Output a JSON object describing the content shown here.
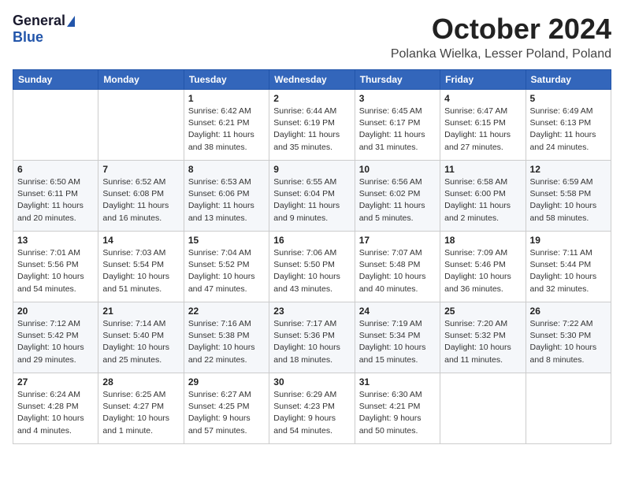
{
  "header": {
    "logo_general": "General",
    "logo_blue": "Blue",
    "month_title": "October 2024",
    "location": "Polanka Wielka, Lesser Poland, Poland"
  },
  "days_of_week": [
    "Sunday",
    "Monday",
    "Tuesday",
    "Wednesday",
    "Thursday",
    "Friday",
    "Saturday"
  ],
  "weeks": [
    [
      {
        "day": "",
        "sunrise": "",
        "sunset": "",
        "daylight": ""
      },
      {
        "day": "",
        "sunrise": "",
        "sunset": "",
        "daylight": ""
      },
      {
        "day": "1",
        "sunrise": "Sunrise: 6:42 AM",
        "sunset": "Sunset: 6:21 PM",
        "daylight": "Daylight: 11 hours and 38 minutes."
      },
      {
        "day": "2",
        "sunrise": "Sunrise: 6:44 AM",
        "sunset": "Sunset: 6:19 PM",
        "daylight": "Daylight: 11 hours and 35 minutes."
      },
      {
        "day": "3",
        "sunrise": "Sunrise: 6:45 AM",
        "sunset": "Sunset: 6:17 PM",
        "daylight": "Daylight: 11 hours and 31 minutes."
      },
      {
        "day": "4",
        "sunrise": "Sunrise: 6:47 AM",
        "sunset": "Sunset: 6:15 PM",
        "daylight": "Daylight: 11 hours and 27 minutes."
      },
      {
        "day": "5",
        "sunrise": "Sunrise: 6:49 AM",
        "sunset": "Sunset: 6:13 PM",
        "daylight": "Daylight: 11 hours and 24 minutes."
      }
    ],
    [
      {
        "day": "6",
        "sunrise": "Sunrise: 6:50 AM",
        "sunset": "Sunset: 6:11 PM",
        "daylight": "Daylight: 11 hours and 20 minutes."
      },
      {
        "day": "7",
        "sunrise": "Sunrise: 6:52 AM",
        "sunset": "Sunset: 6:08 PM",
        "daylight": "Daylight: 11 hours and 16 minutes."
      },
      {
        "day": "8",
        "sunrise": "Sunrise: 6:53 AM",
        "sunset": "Sunset: 6:06 PM",
        "daylight": "Daylight: 11 hours and 13 minutes."
      },
      {
        "day": "9",
        "sunrise": "Sunrise: 6:55 AM",
        "sunset": "Sunset: 6:04 PM",
        "daylight": "Daylight: 11 hours and 9 minutes."
      },
      {
        "day": "10",
        "sunrise": "Sunrise: 6:56 AM",
        "sunset": "Sunset: 6:02 PM",
        "daylight": "Daylight: 11 hours and 5 minutes."
      },
      {
        "day": "11",
        "sunrise": "Sunrise: 6:58 AM",
        "sunset": "Sunset: 6:00 PM",
        "daylight": "Daylight: 11 hours and 2 minutes."
      },
      {
        "day": "12",
        "sunrise": "Sunrise: 6:59 AM",
        "sunset": "Sunset: 5:58 PM",
        "daylight": "Daylight: 10 hours and 58 minutes."
      }
    ],
    [
      {
        "day": "13",
        "sunrise": "Sunrise: 7:01 AM",
        "sunset": "Sunset: 5:56 PM",
        "daylight": "Daylight: 10 hours and 54 minutes."
      },
      {
        "day": "14",
        "sunrise": "Sunrise: 7:03 AM",
        "sunset": "Sunset: 5:54 PM",
        "daylight": "Daylight: 10 hours and 51 minutes."
      },
      {
        "day": "15",
        "sunrise": "Sunrise: 7:04 AM",
        "sunset": "Sunset: 5:52 PM",
        "daylight": "Daylight: 10 hours and 47 minutes."
      },
      {
        "day": "16",
        "sunrise": "Sunrise: 7:06 AM",
        "sunset": "Sunset: 5:50 PM",
        "daylight": "Daylight: 10 hours and 43 minutes."
      },
      {
        "day": "17",
        "sunrise": "Sunrise: 7:07 AM",
        "sunset": "Sunset: 5:48 PM",
        "daylight": "Daylight: 10 hours and 40 minutes."
      },
      {
        "day": "18",
        "sunrise": "Sunrise: 7:09 AM",
        "sunset": "Sunset: 5:46 PM",
        "daylight": "Daylight: 10 hours and 36 minutes."
      },
      {
        "day": "19",
        "sunrise": "Sunrise: 7:11 AM",
        "sunset": "Sunset: 5:44 PM",
        "daylight": "Daylight: 10 hours and 32 minutes."
      }
    ],
    [
      {
        "day": "20",
        "sunrise": "Sunrise: 7:12 AM",
        "sunset": "Sunset: 5:42 PM",
        "daylight": "Daylight: 10 hours and 29 minutes."
      },
      {
        "day": "21",
        "sunrise": "Sunrise: 7:14 AM",
        "sunset": "Sunset: 5:40 PM",
        "daylight": "Daylight: 10 hours and 25 minutes."
      },
      {
        "day": "22",
        "sunrise": "Sunrise: 7:16 AM",
        "sunset": "Sunset: 5:38 PM",
        "daylight": "Daylight: 10 hours and 22 minutes."
      },
      {
        "day": "23",
        "sunrise": "Sunrise: 7:17 AM",
        "sunset": "Sunset: 5:36 PM",
        "daylight": "Daylight: 10 hours and 18 minutes."
      },
      {
        "day": "24",
        "sunrise": "Sunrise: 7:19 AM",
        "sunset": "Sunset: 5:34 PM",
        "daylight": "Daylight: 10 hours and 15 minutes."
      },
      {
        "day": "25",
        "sunrise": "Sunrise: 7:20 AM",
        "sunset": "Sunset: 5:32 PM",
        "daylight": "Daylight: 10 hours and 11 minutes."
      },
      {
        "day": "26",
        "sunrise": "Sunrise: 7:22 AM",
        "sunset": "Sunset: 5:30 PM",
        "daylight": "Daylight: 10 hours and 8 minutes."
      }
    ],
    [
      {
        "day": "27",
        "sunrise": "Sunrise: 6:24 AM",
        "sunset": "Sunset: 4:28 PM",
        "daylight": "Daylight: 10 hours and 4 minutes."
      },
      {
        "day": "28",
        "sunrise": "Sunrise: 6:25 AM",
        "sunset": "Sunset: 4:27 PM",
        "daylight": "Daylight: 10 hours and 1 minute."
      },
      {
        "day": "29",
        "sunrise": "Sunrise: 6:27 AM",
        "sunset": "Sunset: 4:25 PM",
        "daylight": "Daylight: 9 hours and 57 minutes."
      },
      {
        "day": "30",
        "sunrise": "Sunrise: 6:29 AM",
        "sunset": "Sunset: 4:23 PM",
        "daylight": "Daylight: 9 hours and 54 minutes."
      },
      {
        "day": "31",
        "sunrise": "Sunrise: 6:30 AM",
        "sunset": "Sunset: 4:21 PM",
        "daylight": "Daylight: 9 hours and 50 minutes."
      },
      {
        "day": "",
        "sunrise": "",
        "sunset": "",
        "daylight": ""
      },
      {
        "day": "",
        "sunrise": "",
        "sunset": "",
        "daylight": ""
      }
    ]
  ]
}
